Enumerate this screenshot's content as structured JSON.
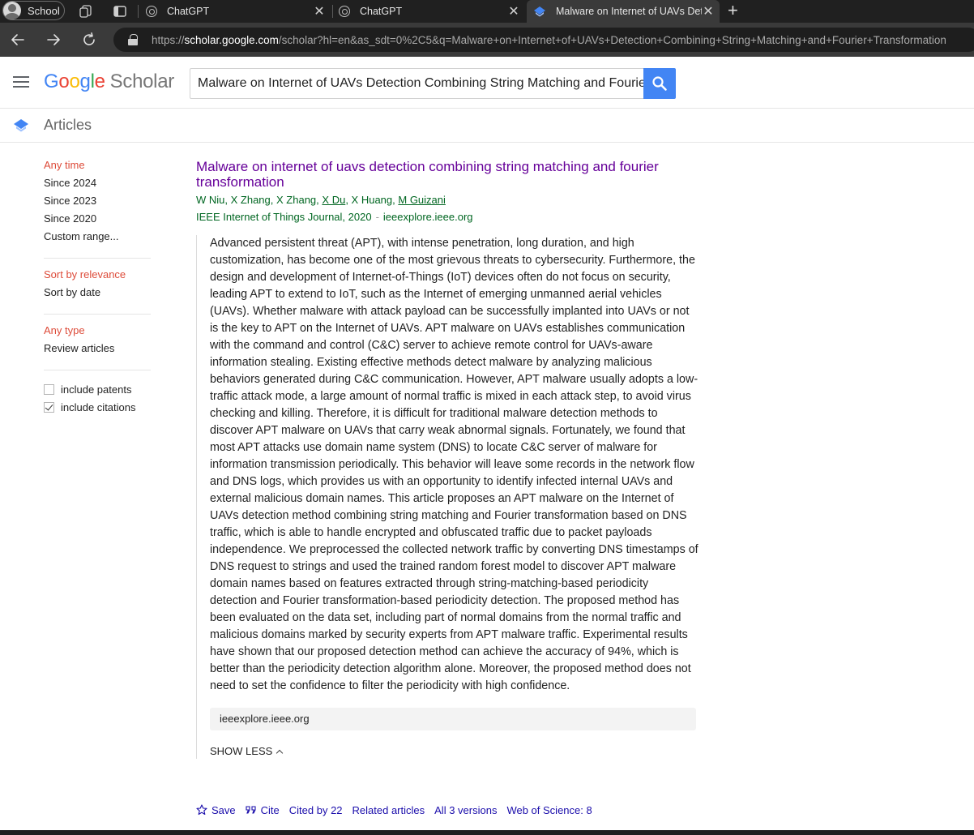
{
  "browser": {
    "profile_label": "School",
    "tabs": [
      {
        "title": "ChatGPT",
        "close": "✕"
      },
      {
        "title": "ChatGPT",
        "close": "✕"
      },
      {
        "title": "Malware on Internet of UAVs Detection Combining String Matching and Fourier Transformation",
        "close": "✕"
      }
    ],
    "new_tab": "+",
    "url_prefix": "https://",
    "url_host": "scholar.google.com",
    "url_rest": "/scholar?hl=en&as_sdt=0%2C5&q=Malware+on+Internet+of+UAVs+Detection+Combining+String+Matching+and+Fourier+Transformation"
  },
  "header": {
    "logo_google": "Google",
    "logo_scholar": "Scholar",
    "search_value": "Malware on Internet of UAVs Detection Combining String Matching and Fourier Transformation",
    "section_label": "Articles"
  },
  "sidebar": {
    "time": [
      "Any time",
      "Since 2024",
      "Since 2023",
      "Since 2020",
      "Custom range..."
    ],
    "sort": [
      "Sort by relevance",
      "Sort by date"
    ],
    "type": [
      "Any type",
      "Review articles"
    ],
    "include_patents": "include patents",
    "include_citations": "include citations"
  },
  "result": {
    "title": "Malware on internet of uavs detection combining string matching and fourier transformation",
    "authors": {
      "a1": "W Niu",
      "a2": "X Zhang",
      "a3": "X Zhang",
      "a4": "X Du",
      "a5": "X Huang",
      "a6": "M Guizani"
    },
    "venue": "IEEE Internet of Things Journal, 2020",
    "venue_sep": "-",
    "venue_source": "ieeexplore.ieee.org",
    "abstract": "Advanced persistent threat (APT), with intense penetration, long duration, and high customization, has become one of the most grievous threats to cybersecurity. Furthermore, the design and development of Internet-of-Things (IoT) devices often do not focus on security, leading APT to extend to IoT, such as the Internet of emerging unmanned aerial vehicles (UAVs). Whether malware with attack payload can be successfully implanted into UAVs or not is the key to APT on the Internet of UAVs. APT malware on UAVs establishes communication with the command and control (C&C) server to achieve remote control for UAVs-aware information stealing. Existing effective methods detect malware by analyzing malicious behaviors generated during C&C communication. However, APT malware usually adopts a low-traffic attack mode, a large amount of normal traffic is mixed in each attack step, to avoid virus checking and killing. Therefore, it is difficult for traditional malware detection methods to discover APT malware on UAVs that carry weak abnormal signals. Fortunately, we found that most APT attacks use domain name system (DNS) to locate C&C server of malware for information transmission periodically. This behavior will leave some records in the network flow and DNS logs, which provides us with an opportunity to identify infected internal UAVs and external malicious domain names. This article proposes an APT malware on the Internet of UAVs detection method combining string matching and Fourier transformation based on DNS traffic, which is able to handle encrypted and obfuscated traffic due to packet payloads independence. We preprocessed the collected network traffic by converting DNS timestamps of DNS request to strings and used the trained random forest model to discover APT malware domain names based on features extracted through string-matching-based periodicity detection and Fourier transformation-based periodicity detection. The proposed method has been evaluated on the data set, including part of normal domains from the normal traffic and malicious domains marked by security experts from APT malware traffic. Experimental results have shown that our proposed detection method can achieve the accuracy of 94%, which is better than the periodicity detection algorithm alone. Moreover, the proposed method does not need to set the confidence to filter the periodicity with high confidence.",
    "source_box": "ieeexplore.ieee.org",
    "show_less": "SHOW LESS",
    "actions": {
      "save": "Save",
      "cite": "Cite",
      "cited_by": "Cited by 22",
      "related": "Related articles",
      "versions": "All 3 versions",
      "wos": "Web of Science: 8"
    }
  },
  "colors": {
    "link": "#1a0dab",
    "visited_title": "#660099",
    "green": "#006621",
    "accent_red": "#dd4b39",
    "search_blue": "#4285f4"
  },
  "icons": [
    "profile-avatar-icon",
    "workspaces-icon",
    "tab-actions-icon",
    "chatgpt-favicon",
    "scholar-favicon",
    "back-arrow-icon",
    "forward-arrow-icon",
    "refresh-icon",
    "lock-icon",
    "hamburger-menu-icon",
    "search-icon",
    "graduation-cap-icon",
    "star-icon",
    "quote-icon",
    "chevron-up-icon"
  ]
}
